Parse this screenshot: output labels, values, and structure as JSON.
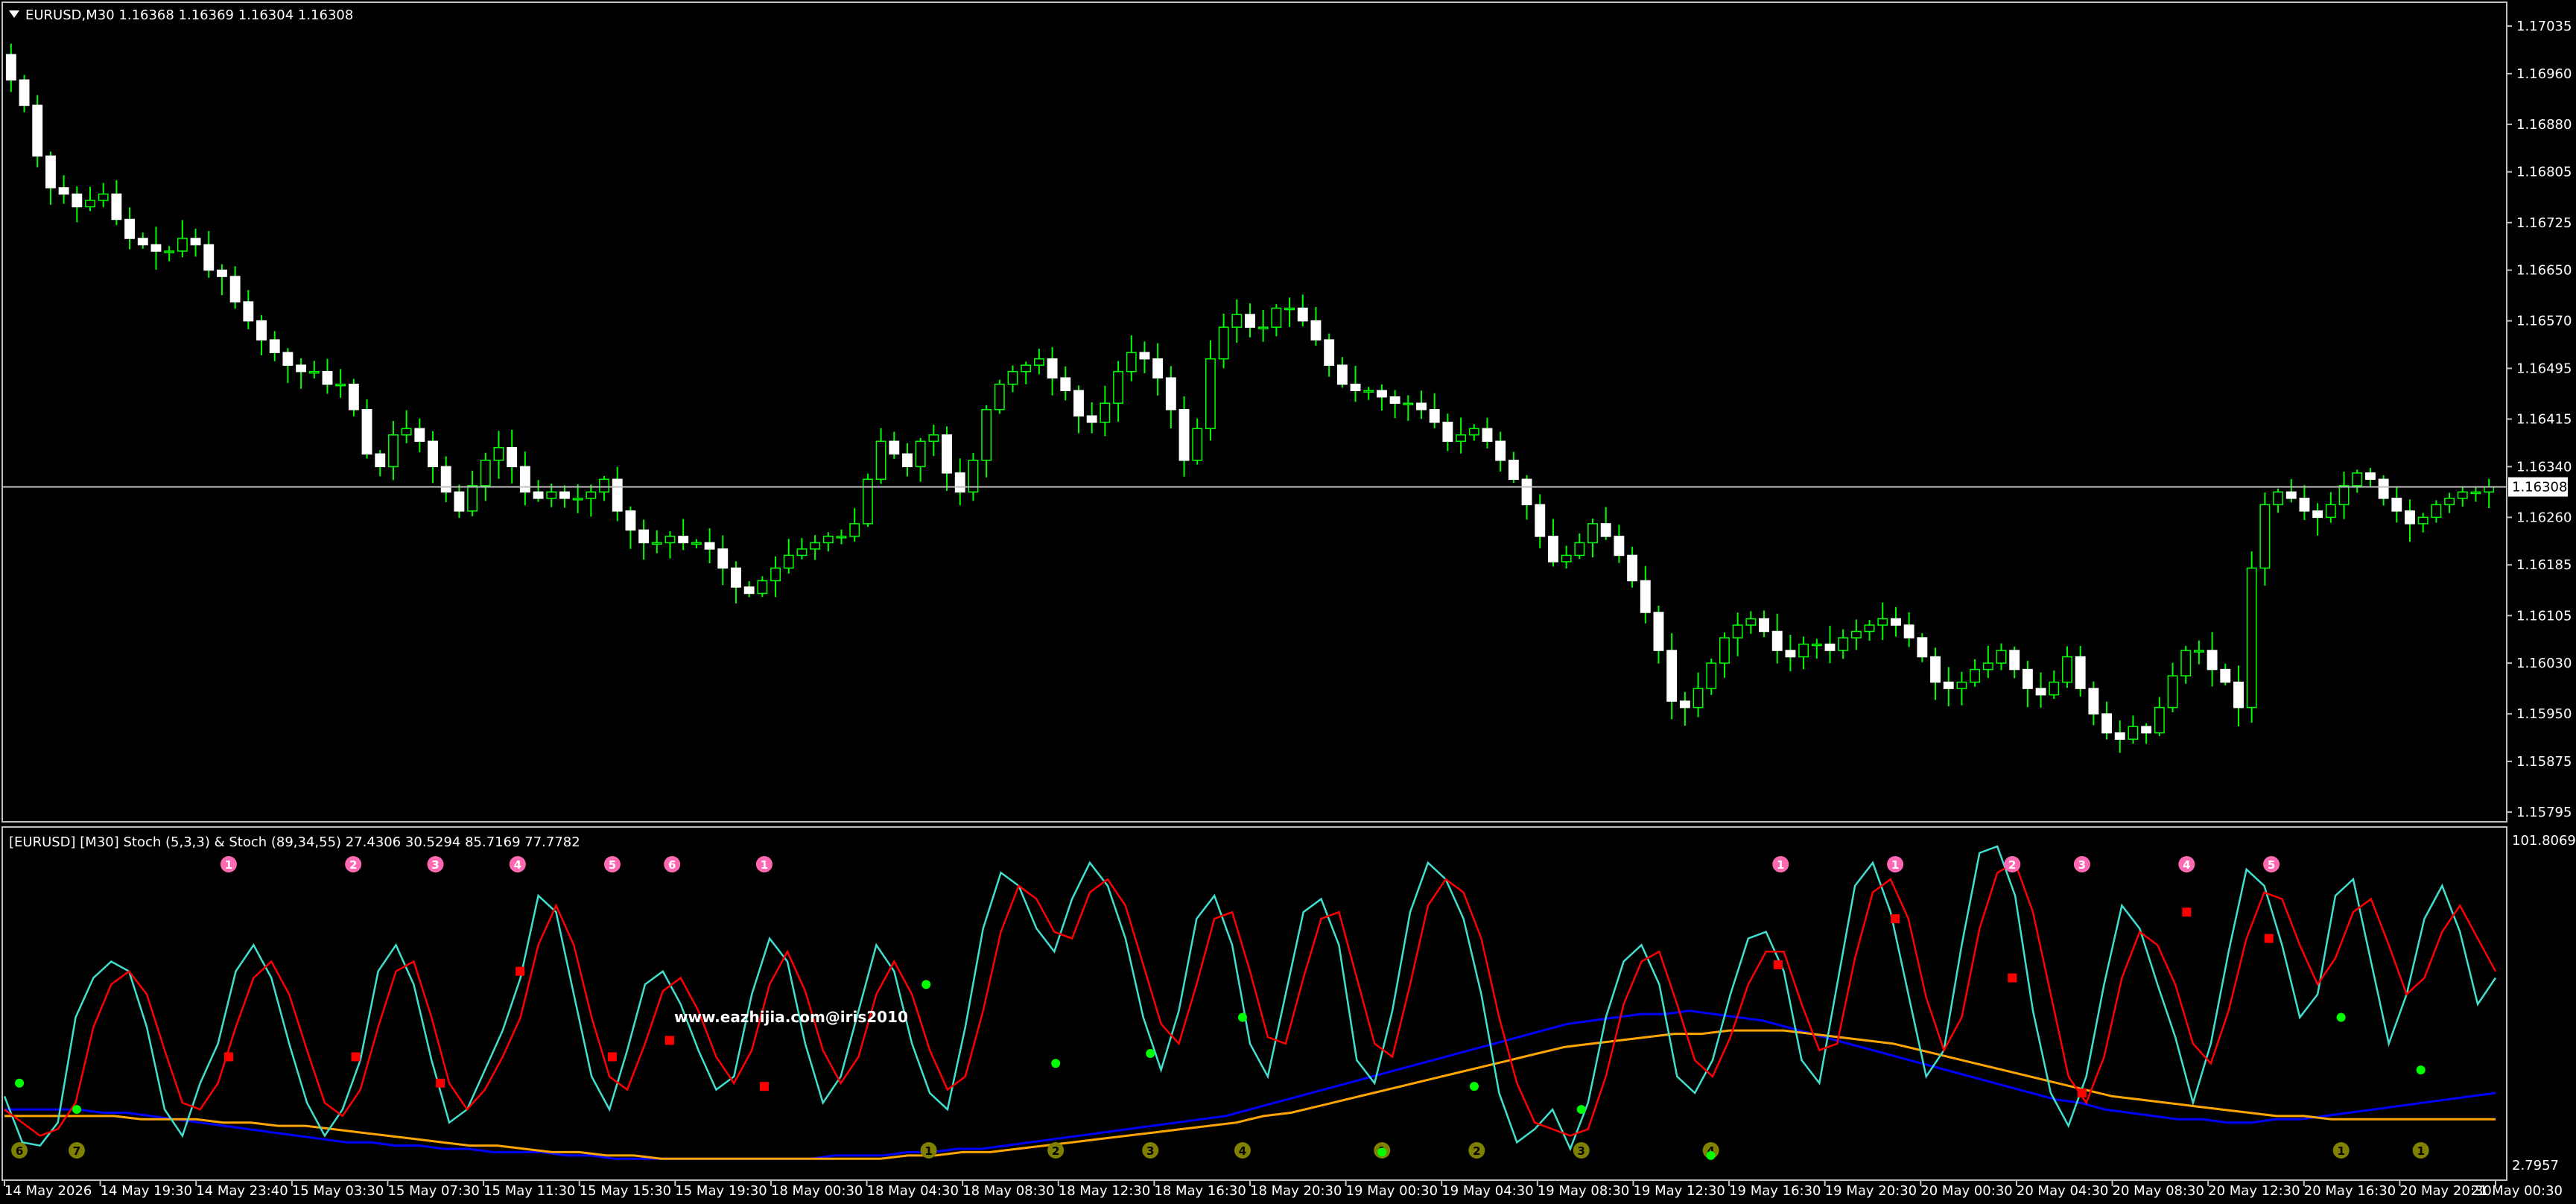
{
  "main": {
    "header": "EURUSD,M30  1.16368 1.16369 1.16304 1.16308",
    "price_labels": [
      "1.17035",
      "1.16960",
      "1.16880",
      "1.16805",
      "1.16725",
      "1.16650",
      "1.16570",
      "1.16495",
      "1.16415",
      "1.16340",
      "1.16260",
      "1.16185",
      "1.16105",
      "1.16030",
      "1.15950",
      "1.15875",
      "1.15795"
    ],
    "current_price": "1.16308",
    "current_price_value": 1.16308,
    "price_range": [
      1.15795,
      1.17035
    ],
    "line_color": "#c0c0c0",
    "candle_up_color": "#ffffff",
    "candle_wick_color": "#00ff00",
    "candle_series": [
      1.1695,
      1.1691,
      1.1683,
      1.1678,
      1.1677,
      1.1675,
      1.1676,
      1.1677,
      1.1673,
      1.167,
      1.1669,
      1.1668,
      1.1668,
      1.167,
      1.1669,
      1.1665,
      1.1664,
      1.166,
      1.1657,
      1.1654,
      1.1652,
      1.165,
      1.1649,
      1.1649,
      1.1647,
      1.1647,
      1.1643,
      1.1636,
      1.1634,
      1.1639,
      1.164,
      1.1638,
      1.1634,
      1.163,
      1.1627,
      1.1631,
      1.1635,
      1.1637,
      1.1634,
      1.163,
      1.1629,
      1.163,
      1.1629,
      1.1629,
      1.163,
      1.1632,
      1.1627,
      1.1624,
      1.1622,
      1.1622,
      1.1623,
      1.1622,
      1.1622,
      1.1621,
      1.1618,
      1.1615,
      1.1614,
      1.1616,
      1.1618,
      1.162,
      1.1621,
      1.1622,
      1.1623,
      1.1623,
      1.1625,
      1.1632,
      1.1638,
      1.1636,
      1.1634,
      1.1638,
      1.1639,
      1.1633,
      1.163,
      1.1635,
      1.1643,
      1.1647,
      1.1649,
      1.165,
      1.1651,
      1.1648,
      1.1646,
      1.1642,
      1.1641,
      1.1644,
      1.1649,
      1.1652,
      1.1651,
      1.1648,
      1.1643,
      1.1635,
      1.164,
      1.1651,
      1.1656,
      1.1658,
      1.1656,
      1.1656,
      1.1659,
      1.1659,
      1.1657,
      1.1654,
      1.165,
      1.1647,
      1.1646,
      1.1646,
      1.1645,
      1.1644,
      1.1644,
      1.1643,
      1.1641,
      1.1638,
      1.1639,
      1.164,
      1.1638,
      1.1635,
      1.1632,
      1.1628,
      1.1623,
      1.1619,
      1.162,
      1.1622,
      1.1625,
      1.1623,
      1.162,
      1.1616,
      1.1611,
      1.1605,
      1.1597,
      1.1596,
      1.1599,
      1.1603,
      1.1607,
      1.1609,
      1.161,
      1.1608,
      1.1605,
      1.1604,
      1.1606,
      1.1606,
      1.1605,
      1.1607,
      1.1608,
      1.1609,
      1.161,
      1.1609,
      1.1607,
      1.1604,
      1.16,
      1.1599,
      1.16,
      1.1602,
      1.1603,
      1.1605,
      1.1602,
      1.1599,
      1.1598,
      1.16,
      1.1604,
      1.1599,
      1.1595,
      1.1592,
      1.1591,
      1.1593,
      1.1592,
      1.1596,
      1.1601,
      1.1605,
      1.1605,
      1.1602,
      1.16,
      1.1596,
      1.1618,
      1.1628,
      1.163,
      1.1629,
      1.1627,
      1.1626,
      1.1628,
      1.1631,
      1.1633,
      1.1632,
      1.1629,
      1.1627,
      1.1625,
      1.1626,
      1.1628,
      1.1629,
      1.163,
      1.163,
      1.16308
    ],
    "watermark": "www.eazhijia.com@iris2010"
  },
  "stoch": {
    "header": "[EURUSD] [M30] Stoch (5,3,3) & Stoch (89,34,55) 27.4306 30.5294 85.7169 77.7782",
    "top_label": "101.8069",
    "bottom_label": "2.7957",
    "range": [
      2.7957,
      101.8069
    ],
    "colors": {
      "fast_main": "#40e0d0",
      "fast_signal": "#ff0000",
      "slow_main": "#0000ff",
      "slow_signal": "#ffa500",
      "marker_pink": "#ff69b4",
      "marker_olive": "#808000",
      "dot_green": "#00ff00",
      "dot_red": "#ff0000"
    },
    "fast_main": [
      24,
      10,
      9,
      16,
      48,
      60,
      65,
      62,
      45,
      20,
      12,
      28,
      40,
      62,
      70,
      60,
      40,
      22,
      12,
      20,
      35,
      62,
      70,
      58,
      35,
      16,
      20,
      32,
      44,
      60,
      85,
      80,
      55,
      30,
      20,
      38,
      58,
      62,
      52,
      38,
      26,
      30,
      55,
      72,
      65,
      40,
      22,
      30,
      50,
      70,
      62,
      40,
      25,
      20,
      45,
      75,
      92,
      88,
      75,
      68,
      84,
      95,
      88,
      72,
      48,
      32,
      50,
      78,
      85,
      70,
      40,
      30,
      55,
      80,
      84,
      70,
      35,
      28,
      50,
      80,
      95,
      90,
      78,
      55,
      25,
      10,
      14,
      20,
      8,
      22,
      48,
      65,
      70,
      58,
      30,
      25,
      35,
      55,
      72,
      74,
      62,
      35,
      28,
      58,
      88,
      95,
      80,
      55,
      30,
      38,
      70,
      98,
      100,
      85,
      50,
      25,
      15,
      30,
      58,
      82,
      75,
      58,
      42,
      22,
      40,
      68,
      93,
      88,
      70,
      48,
      55,
      85,
      90,
      65,
      40,
      55,
      78,
      88,
      74,
      52,
      60
    ],
    "fast_signal": [
      20,
      16,
      12,
      14,
      22,
      45,
      58,
      62,
      55,
      38,
      22,
      20,
      28,
      45,
      60,
      65,
      55,
      38,
      22,
      18,
      26,
      45,
      62,
      65,
      48,
      28,
      20,
      26,
      36,
      48,
      70,
      82,
      70,
      48,
      30,
      26,
      40,
      56,
      60,
      50,
      36,
      28,
      38,
      58,
      68,
      56,
      38,
      28,
      36,
      55,
      65,
      55,
      38,
      26,
      30,
      50,
      74,
      88,
      84,
      74,
      72,
      86,
      90,
      82,
      64,
      46,
      40,
      58,
      78,
      80,
      62,
      42,
      40,
      60,
      78,
      80,
      60,
      40,
      36,
      58,
      82,
      90,
      86,
      72,
      48,
      28,
      16,
      14,
      12,
      14,
      30,
      52,
      65,
      68,
      52,
      35,
      30,
      42,
      58,
      68,
      68,
      52,
      38,
      40,
      66,
      86,
      90,
      78,
      54,
      38,
      48,
      75,
      92,
      95,
      80,
      55,
      30,
      22,
      36,
      60,
      74,
      70,
      58,
      40,
      34,
      50,
      72,
      86,
      84,
      70,
      58,
      66,
      80,
      84,
      70,
      55,
      60,
      74,
      82,
      72,
      62
    ],
    "slow_main": [
      20,
      20,
      20,
      20,
      19,
      19,
      18,
      17,
      16,
      15,
      14,
      13,
      12,
      11,
      10,
      10,
      9,
      9,
      8,
      8,
      7,
      7,
      7,
      6,
      6,
      5,
      5,
      5,
      5,
      5,
      5,
      5,
      5,
      5,
      6,
      6,
      6,
      7,
      7,
      8,
      8,
      9,
      10,
      11,
      12,
      13,
      14,
      15,
      16,
      17,
      18,
      20,
      22,
      24,
      26,
      28,
      30,
      32,
      34,
      36,
      38,
      40,
      42,
      44,
      46,
      47,
      48,
      49,
      49,
      50,
      49,
      48,
      47,
      45,
      43,
      41,
      39,
      37,
      35,
      33,
      31,
      29,
      27,
      25,
      23,
      22,
      20,
      19,
      18,
      17,
      17,
      16,
      16,
      17,
      17,
      18,
      19,
      20,
      21,
      22,
      23,
      24,
      25
    ],
    "slow_signal": [
      18,
      18,
      18,
      18,
      18,
      17,
      17,
      17,
      16,
      16,
      15,
      15,
      14,
      13,
      12,
      11,
      10,
      9,
      9,
      8,
      7,
      7,
      6,
      6,
      5,
      5,
      5,
      5,
      5,
      5,
      5,
      5,
      5,
      6,
      6,
      7,
      7,
      8,
      9,
      10,
      11,
      12,
      13,
      14,
      15,
      16,
      18,
      19,
      21,
      23,
      25,
      27,
      29,
      31,
      33,
      35,
      37,
      39,
      40,
      41,
      42,
      43,
      43,
      44,
      44,
      44,
      43,
      42,
      41,
      40,
      38,
      36,
      34,
      32,
      30,
      28,
      26,
      24,
      23,
      22,
      21,
      20,
      19,
      18,
      18,
      17,
      17,
      17,
      17,
      17,
      17,
      17
    ],
    "pink_markers": [
      [
        "1",
        0.09
      ],
      [
        "2",
        0.14
      ],
      [
        "3",
        0.173
      ],
      [
        "4",
        0.206
      ],
      [
        "5",
        0.244
      ],
      [
        "6",
        0.268
      ],
      [
        "1",
        0.305
      ],
      [
        "1",
        0.713
      ],
      [
        "1",
        0.759
      ],
      [
        "2",
        0.806
      ],
      [
        "3",
        0.834
      ],
      [
        "4",
        0.876
      ],
      [
        "5",
        0.91
      ]
    ],
    "olive_markers": [
      [
        "6",
        0.006
      ],
      [
        "7",
        0.029
      ],
      [
        "1",
        0.371
      ],
      [
        "2",
        0.422
      ],
      [
        "3",
        0.46
      ],
      [
        "4",
        0.497
      ],
      [
        "1",
        0.553
      ],
      [
        "2",
        0.591
      ],
      [
        "3",
        0.633
      ],
      [
        "4",
        0.685
      ],
      [
        "1",
        0.938
      ],
      [
        "1",
        0.97
      ]
    ],
    "green_dots": [
      [
        0.006,
        28
      ],
      [
        0.029,
        20
      ],
      [
        0.37,
        58
      ],
      [
        0.422,
        34
      ],
      [
        0.46,
        37
      ],
      [
        0.497,
        48
      ],
      [
        0.553,
        7
      ],
      [
        0.59,
        27
      ],
      [
        0.633,
        20
      ],
      [
        0.685,
        6
      ],
      [
        0.938,
        48
      ],
      [
        0.97,
        32
      ]
    ],
    "red_dots": [
      [
        0.09,
        36
      ],
      [
        0.141,
        36
      ],
      [
        0.175,
        28
      ],
      [
        0.207,
        62
      ],
      [
        0.244,
        36
      ],
      [
        0.267,
        41
      ],
      [
        0.305,
        27
      ],
      [
        0.712,
        64
      ],
      [
        0.759,
        78
      ],
      [
        0.806,
        60
      ],
      [
        0.834,
        25
      ],
      [
        0.876,
        80
      ],
      [
        0.909,
        72
      ]
    ]
  },
  "time_labels": [
    "14 May 2026",
    "14 May 19:30",
    "14 May 23:40",
    "15 May 03:30",
    "15 May 07:30",
    "15 May 11:30",
    "15 May 15:30",
    "15 May 19:30",
    "18 May 00:30",
    "18 May 04:30",
    "18 May 08:30",
    "18 May 12:30",
    "18 May 16:30",
    "18 May 20:30",
    "19 May 00:30",
    "19 May 04:30",
    "19 May 08:30",
    "19 May 12:30",
    "19 May 16:30",
    "19 May 20:30",
    "20 May 00:30",
    "20 May 04:30",
    "20 May 08:30",
    "20 May 12:30",
    "20 May 16:30",
    "20 May 20:30",
    "21 May 00:30"
  ]
}
